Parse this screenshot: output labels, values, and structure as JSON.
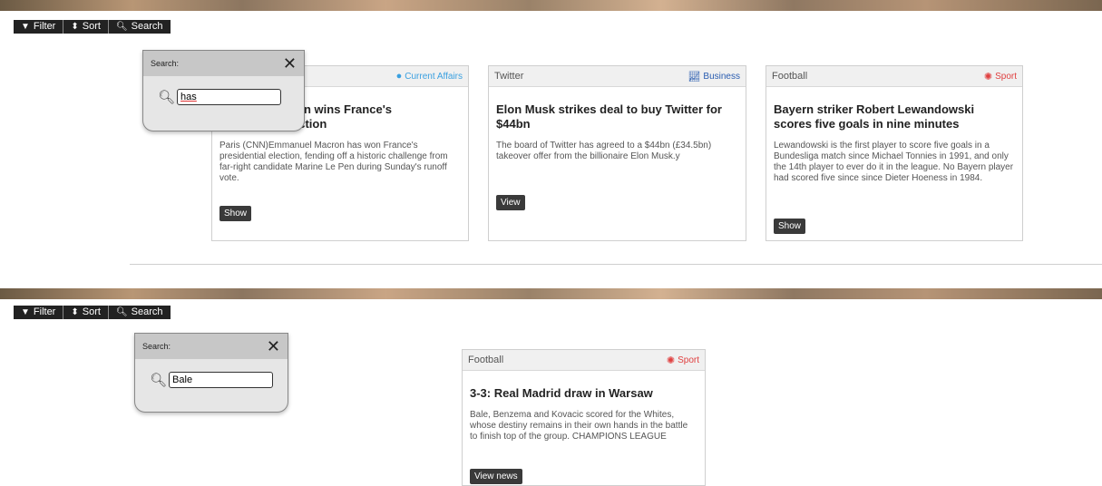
{
  "toolbar": {
    "filter": "Filter",
    "sort": "Sort",
    "search": "Search"
  },
  "top": {
    "popup": {
      "title": "Search:",
      "value": "has"
    },
    "cards": [
      {
        "header": "",
        "category": "Current Affairs",
        "category_icon": "globe-icon",
        "category_color": "#3aa0e0",
        "title": "ron wins France's\nection",
        "body": "Paris (CNN)Emmanuel Macron has won France's presidential election, fending off a historic challenge from far-right candidate Marine Le Pen during Sunday's runoff vote.",
        "button": "Show"
      },
      {
        "header": "Twitter",
        "category": "Business",
        "category_icon": "chart-icon",
        "category_color": "#2a5db0",
        "title": "Elon Musk strikes deal to buy Twitter for $44bn",
        "body": "The board of Twitter has agreed to a $44bn (£34.5bn) takeover offer from the billionaire Elon Musk.y",
        "button": "View"
      },
      {
        "header": "Football",
        "category": "Sport",
        "category_icon": "basketball-icon",
        "category_color": "#e04040",
        "title": "Bayern striker Robert Lewandowski scores five goals in nine minutes",
        "body": "Lewandowski is the first player to score five goals in a Bundesliga match since Michael Tonnies in 1991, and only the 14th player to ever do it in the league. No Bayern player had scored five since since Dieter Hoeness in 1984.",
        "button": "Show"
      }
    ]
  },
  "bottom": {
    "popup": {
      "title": "Search:",
      "value": "Bale"
    },
    "cards": [
      {
        "header": "Football",
        "category": "Sport",
        "category_icon": "basketball-icon",
        "category_color": "#e04040",
        "title": "3-3: Real Madrid draw in Warsaw",
        "body": "Bale, Benzema and Kovacic scored for the Whites, whose destiny remains in their own hands in the battle to finish top of the group. CHAMPIONS LEAGUE",
        "button": "View news"
      }
    ]
  }
}
